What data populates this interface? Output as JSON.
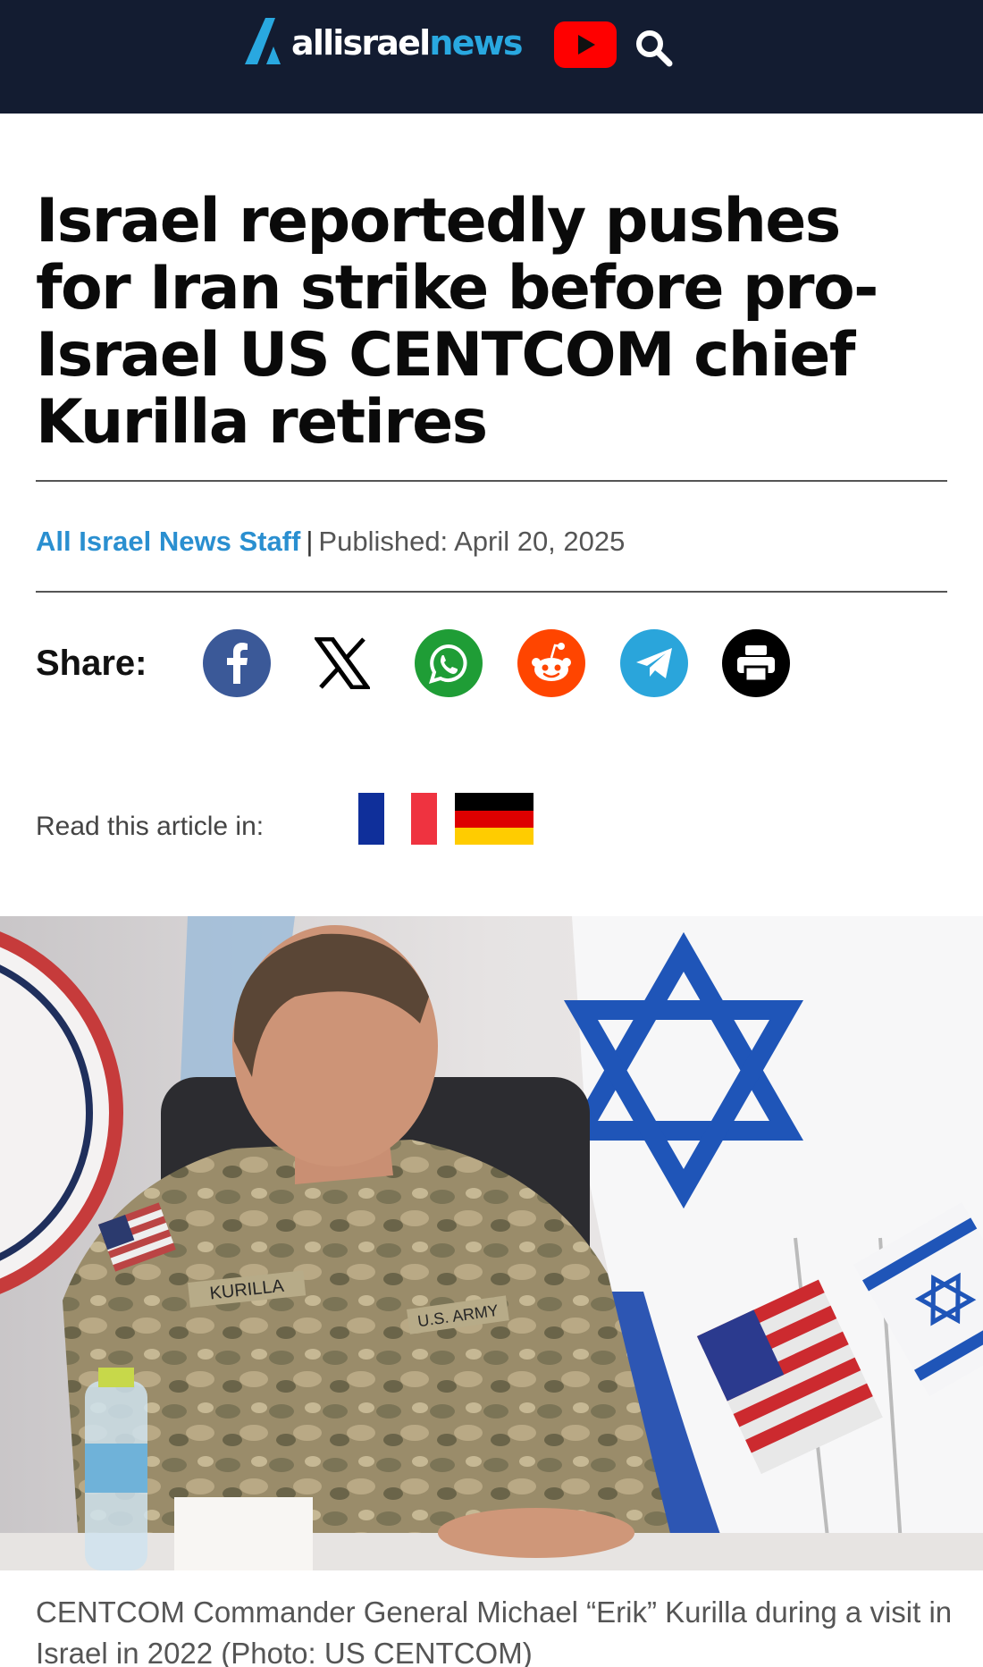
{
  "site": {
    "logo_part1": "allisrael",
    "logo_part2": "news",
    "icons": [
      "allisraelnews-logo-icon",
      "youtube-icon",
      "search-icon"
    ]
  },
  "article": {
    "title": "Israel reportedly pushes for Iran strike before pro-Israel US CENTCOM chief Kurilla retires",
    "author": "All Israel News Staff",
    "separator": "|",
    "published": "Published: April 20, 2025"
  },
  "share": {
    "label": "Share:",
    "buttons": [
      "facebook",
      "x",
      "whatsapp",
      "reddit",
      "telegram",
      "print"
    ],
    "colors": {
      "facebook": "#3b5998",
      "x": "#000000",
      "whatsapp": "#1f9d36",
      "reddit": "#ff4500",
      "telegram": "#2aa5db",
      "print": "#000000"
    }
  },
  "translations": {
    "label": "Read this article in:",
    "languages": [
      "French",
      "German"
    ]
  },
  "photo": {
    "name_tape": "KURILLA",
    "branch_tape": "U.S. ARMY",
    "caption": "CENTCOM Commander General Michael “Erik” Kurilla during a visit in Israel in 2022 (Photo: US CENTCOM)"
  },
  "colors": {
    "header_bg": "#131c31",
    "accent": "#29a8e0",
    "author_link": "#2a8fd0"
  }
}
